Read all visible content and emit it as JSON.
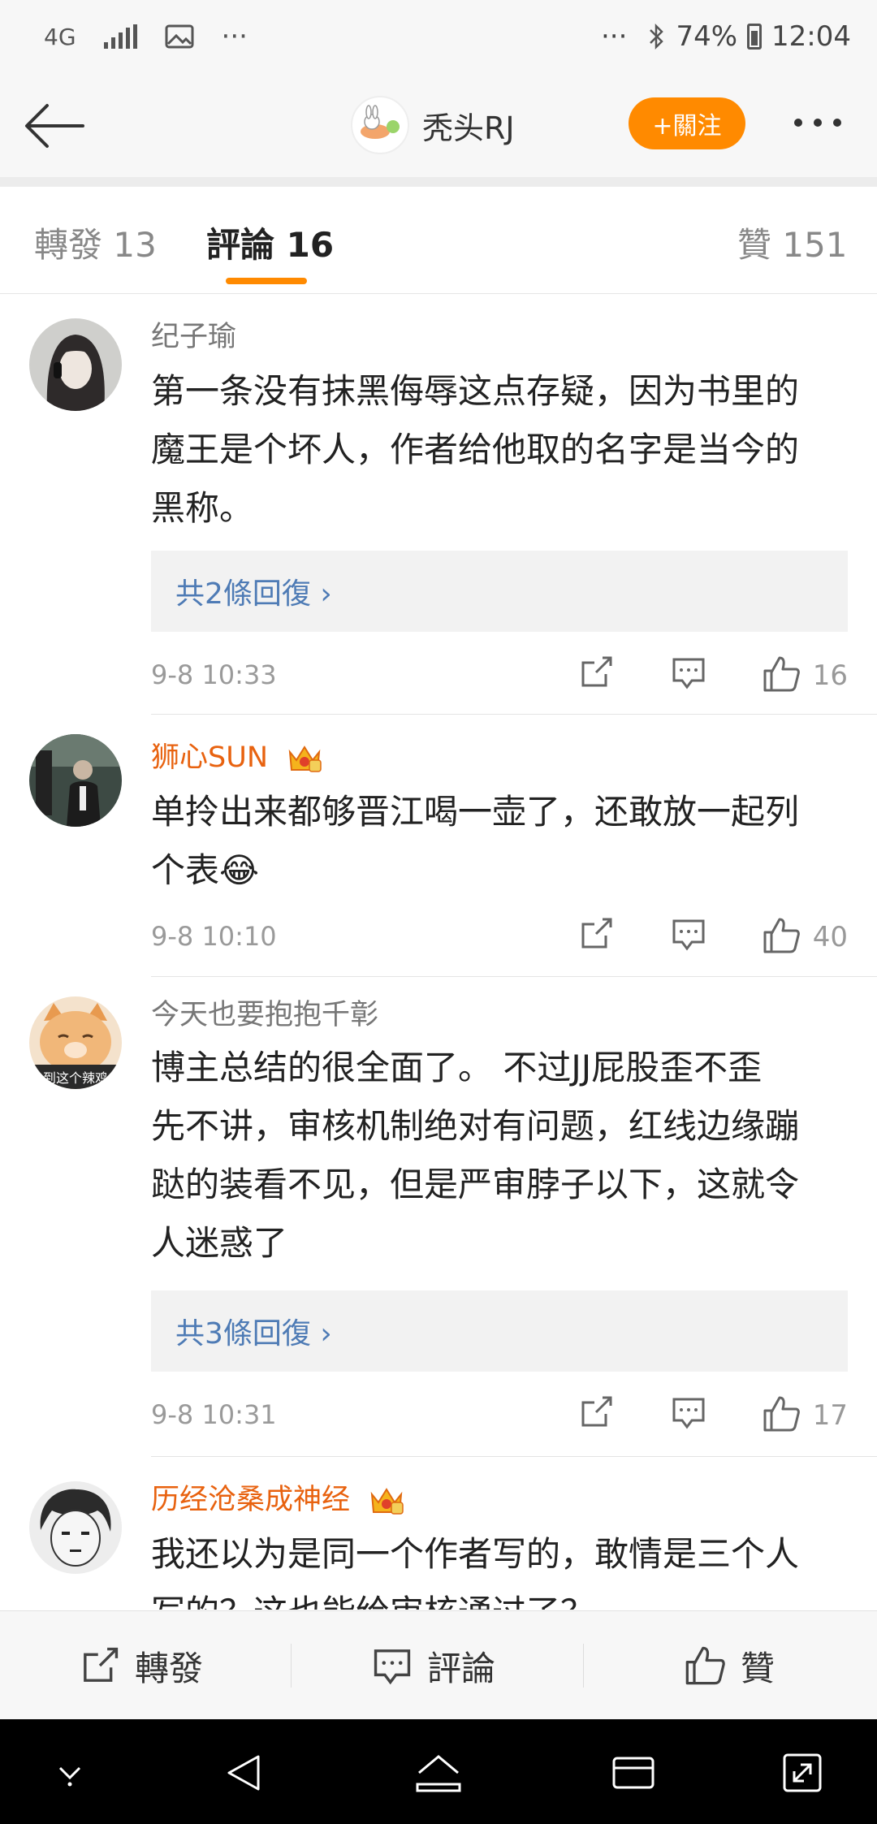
{
  "status_bar": {
    "network": "4G",
    "dots_left": "···",
    "dots_right": "···",
    "battery": "74%",
    "time": "12:04"
  },
  "header": {
    "back_icon": "back-arrow-icon",
    "username": "秃头RJ",
    "follow_label": "+關注",
    "more_icon": "more-dots-icon"
  },
  "tabs": {
    "repost": "轉發 13",
    "comments": "評論 16",
    "likes": "贊 151"
  },
  "comments": [
    {
      "name": "纪子瑜",
      "vip": false,
      "lines": [
        "第一条没有抹黑侮辱这点存疑，因为书里的",
        "魔王是个坏人，作者给他取的名字是当今的",
        "黑称。"
      ],
      "replies": "共2條回復 ›",
      "time": "9-8 10:33",
      "likes": "16"
    },
    {
      "name": "狮心SUN",
      "vip": true,
      "lines": [
        "单拎出来都够晋江喝一壶了，还敢放一起列",
        "个表😂"
      ],
      "replies": "",
      "time": "9-8 10:10",
      "likes": "40"
    },
    {
      "name": "今天也要抱抱千彰",
      "vip": false,
      "lines": [
        "博主总结的很全面了。 不过JJ屁股歪不歪",
        "先不讲，审核机制绝对有问题，红线边缘蹦",
        "跶的装看不见，但是严审脖子以下，这就令",
        "人迷惑了"
      ],
      "replies": "共3條回復 ›",
      "time": "9-8 10:31",
      "likes": "17"
    },
    {
      "name": "历经沧桑成神经",
      "vip": true,
      "lines": [
        "我还以为是同一个作者写的，敢情是三个人",
        "写的？这也能给审核通过了？"
      ],
      "replies": "",
      "time": "",
      "likes": ""
    }
  ],
  "avatar_badge_text": "到这个辣鸡",
  "bottom_bar": {
    "repost": "轉發",
    "comment": "評論",
    "like": "贊"
  },
  "colors": {
    "accent": "#ff8a00",
    "vip_name": "#e8620f",
    "link": "#4e7bb5"
  }
}
